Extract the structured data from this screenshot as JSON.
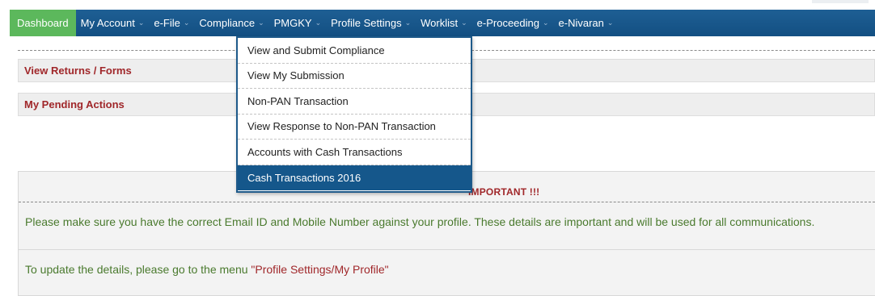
{
  "nav": {
    "items": [
      {
        "label": "Dashboard",
        "caret": "",
        "active": true
      },
      {
        "label": "My Account",
        "caret": "⌄"
      },
      {
        "label": "e-File",
        "caret": "⌄"
      },
      {
        "label": "Compliance",
        "caret": "⌄"
      },
      {
        "label": "PMGKY",
        "caret": "⌄"
      },
      {
        "label": "Profile Settings",
        "caret": "⌄"
      },
      {
        "label": "Worklist",
        "caret": "⌄"
      },
      {
        "label": "e-Proceeding",
        "caret": "⌄"
      },
      {
        "label": "e-Nivaran",
        "caret": "⌄"
      }
    ]
  },
  "compliance_menu": {
    "items": [
      {
        "label": "View and Submit Compliance"
      },
      {
        "label": "View My Submission"
      },
      {
        "label": "Non-PAN Transaction"
      },
      {
        "label": "View Response to Non-PAN Transaction"
      },
      {
        "label": "Accounts with Cash Transactions"
      },
      {
        "label": "Cash Transactions 2016",
        "highlighted": true
      }
    ]
  },
  "panels": {
    "view_returns": "View Returns / Forms",
    "pending_actions": "My Pending Actions"
  },
  "notice": {
    "title": "IMPORTANT !!!",
    "message": "Please make sure you have the correct Email ID and Mobile Number against your profile. These details are important and will be used for all communications.",
    "update_prefix": "To update the details, please go to the menu ",
    "update_link": "\"Profile Settings/My Profile\""
  },
  "colors": {
    "nav_bg": "#134f82",
    "active_tab": "#5cb85c",
    "panel_title": "#a0272a",
    "notice_text": "#4a7a2e",
    "menu_highlight": "#15578b"
  }
}
